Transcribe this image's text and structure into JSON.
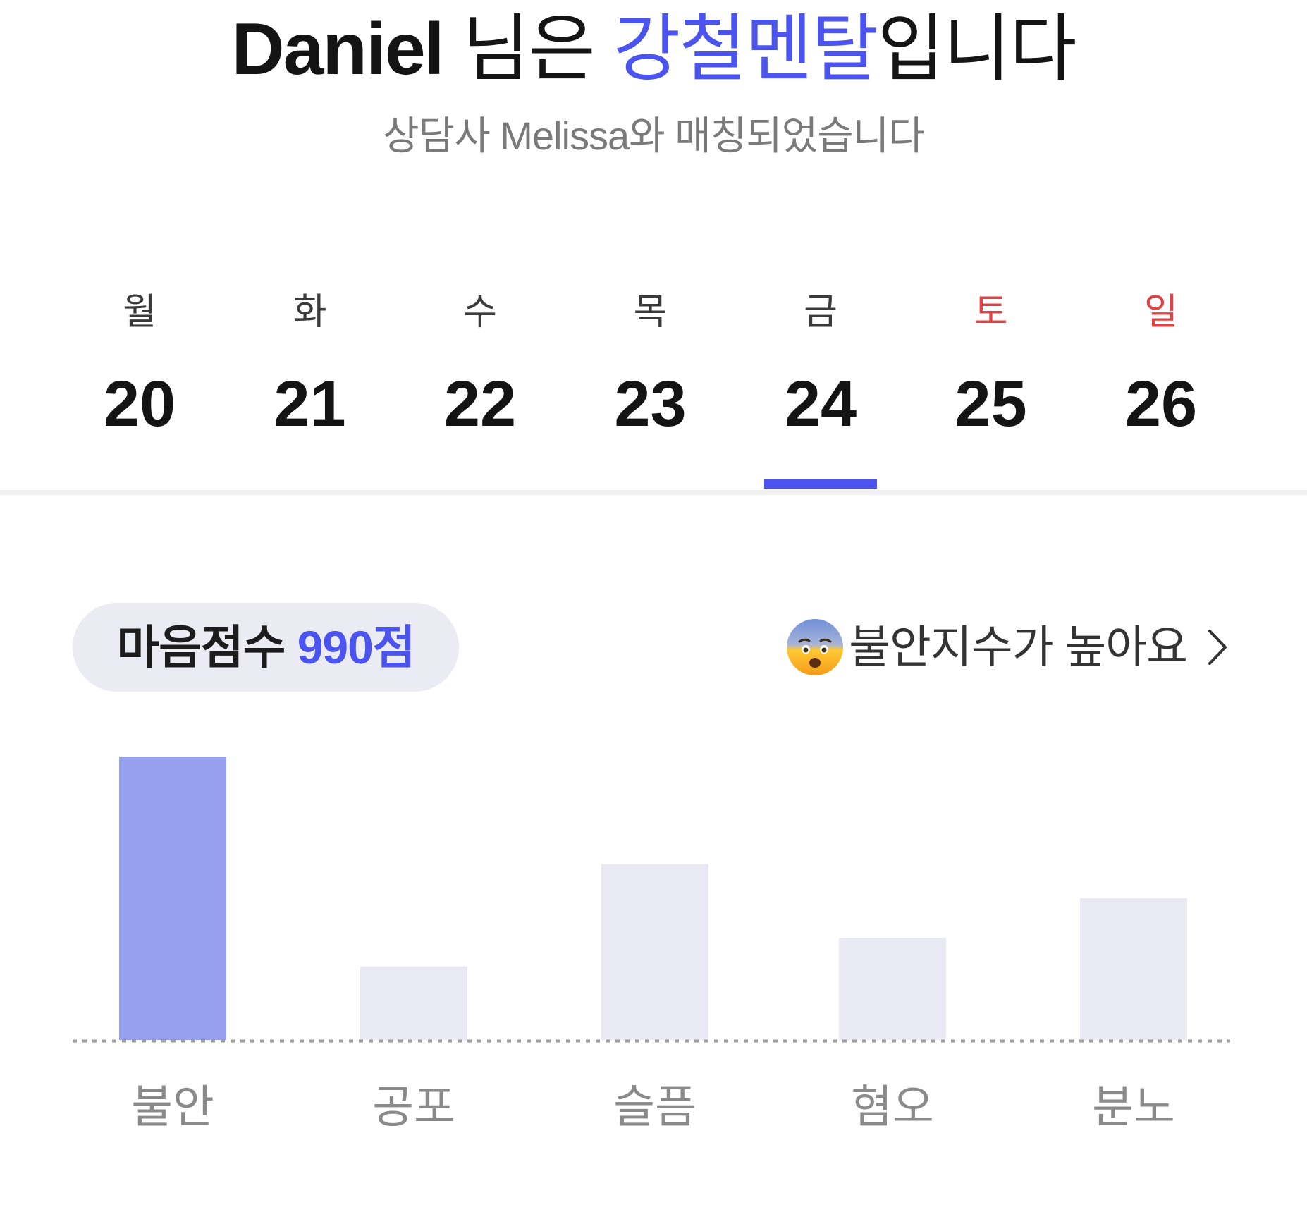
{
  "header": {
    "user_name": "Daniel",
    "title_mid": " 님은 ",
    "mind_type": "강철멘탈",
    "title_end": "입니다",
    "mind_type_color": "#4b54ee",
    "subtitle": "상담사 Melissa와 매칭되었습니다"
  },
  "week": {
    "selected_index": 4,
    "days": [
      {
        "dow": "월",
        "date": "20",
        "weekend": false
      },
      {
        "dow": "화",
        "date": "21",
        "weekend": false
      },
      {
        "dow": "수",
        "date": "22",
        "weekend": false
      },
      {
        "dow": "목",
        "date": "23",
        "weekend": false
      },
      {
        "dow": "금",
        "date": "24",
        "weekend": false
      },
      {
        "dow": "토",
        "date": "25",
        "weekend": true
      },
      {
        "dow": "일",
        "date": "26",
        "weekend": true
      }
    ],
    "accent_color": "#4b54ee",
    "weekend_color": "#e04343"
  },
  "score": {
    "label": "마음점수",
    "value": "990점"
  },
  "alert": {
    "icon": "anxious-face-icon",
    "text": "불안지수가 높아요"
  },
  "chart_data": {
    "type": "bar",
    "categories": [
      "불안",
      "공포",
      "슬픔",
      "혐오",
      "분노"
    ],
    "values": [
      100,
      26,
      62,
      36,
      50
    ],
    "highlight_index": 0,
    "highlight_color": "#95a0ee",
    "bar_color": "#e9e9f4",
    "ylim": [
      0,
      100
    ],
    "baseline": "dotted",
    "grid": false
  }
}
